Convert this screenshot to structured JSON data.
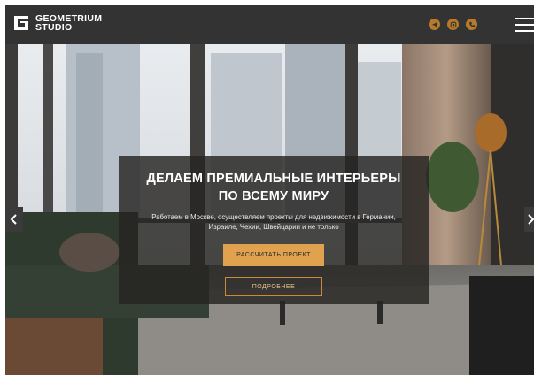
{
  "header": {
    "logo_line1": "GEOMETRIUM",
    "logo_line2": "STUDIO",
    "social_icons": [
      "telegram-icon",
      "instagram-icon",
      "phone-icon"
    ],
    "menu_icon": "hamburger-menu-icon",
    "accent_color": "#b87a2a"
  },
  "hero": {
    "title_line1": "ДЕЛАЕМ ПРЕМИАЛЬНЫЕ ИНТЕРЬЕРЫ",
    "title_line2": "ПО ВСЕМУ МИРУ",
    "subtitle_line1": "Работаем в Москве, осуществляем проекты для недвижимости в Германии,",
    "subtitle_line2": "Израиле, Чехии, Швейцарии и не только",
    "primary_button": "РАССЧИТАТЬ ПРОЕКТ",
    "secondary_button": "ПОДРОБНЕЕ",
    "button_color": "#e0a24e",
    "prev_arrow": "chevron-left-icon",
    "next_arrow": "chevron-right-icon"
  }
}
